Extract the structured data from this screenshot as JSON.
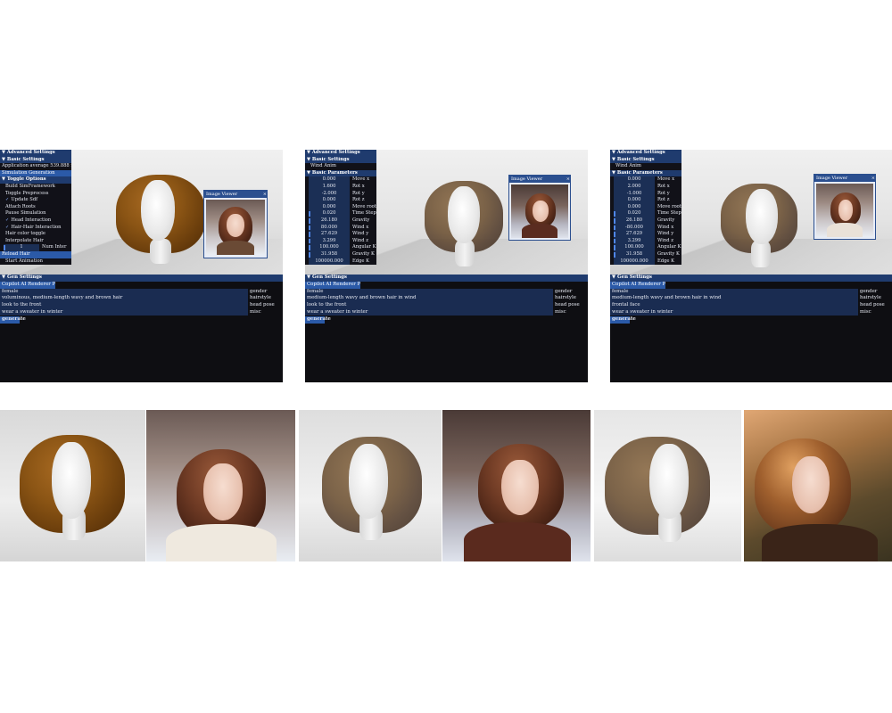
{
  "panel1": {
    "ui_rows": [
      {
        "text": "Advanced Settings",
        "style": "hdr"
      },
      {
        "text": "Basic Settings",
        "style": "hdr"
      },
      {
        "text": "Application average 539.888 ms/f",
        "style": "plain"
      },
      {
        "text": "Simulation Generation",
        "style": "sel"
      },
      {
        "text": "Toggle Options",
        "style": "hdr"
      },
      {
        "text": "Build SimFramework",
        "style": "sub"
      },
      {
        "text": "Toggle Preprocess",
        "style": "sub"
      },
      {
        "text": "Update Sdf",
        "style": "chk"
      },
      {
        "text": "Attach Roots",
        "style": "sub"
      },
      {
        "text": "Pause Simulation",
        "style": "sub"
      },
      {
        "text": "Head Interaction",
        "style": "chk"
      },
      {
        "text": "Hair-Hair Interaction",
        "style": "chk"
      },
      {
        "text": "Hair color toggle",
        "style": "sub"
      },
      {
        "text": "Interpolate Hair",
        "style": "sub"
      }
    ],
    "num_input": {
      "value": "1",
      "label": "Num Inter"
    },
    "reload_label": "Reload Hair",
    "start_label": "Start Animation",
    "image_viewer_title": "Image Viewer",
    "gen": {
      "header": "Gen Settings",
      "section": "Copilot AI Renderer Perm",
      "rows": [
        {
          "value": "female",
          "label": "gender"
        },
        {
          "value": "voluminous, medium-length wavy and brown hair",
          "label": "hairstyle"
        },
        {
          "value": "look to the front",
          "label": "head pose"
        },
        {
          "value": "wear a sweater in winter",
          "label": "misc"
        }
      ],
      "button": "generate"
    }
  },
  "panel2": {
    "ui_rows": [
      {
        "text": "Advanced Settings",
        "style": "hdr"
      },
      {
        "text": "Basic Settings",
        "style": "hdr"
      },
      {
        "text": "Wind Anim",
        "style": "sub"
      },
      {
        "text": "Basic Parameters",
        "style": "hdr"
      }
    ],
    "params": [
      {
        "value": "0.000",
        "label": "Move x",
        "bar": false
      },
      {
        "value": "1.600",
        "label": "Rot x",
        "bar": false
      },
      {
        "value": "-2.000",
        "label": "Rot y",
        "bar": false
      },
      {
        "value": "0.000",
        "label": "Rot z",
        "bar": false
      },
      {
        "value": "0.000",
        "label": "Move root",
        "bar": false
      },
      {
        "value": "0.020",
        "label": "Time Step",
        "bar": true
      },
      {
        "value": "26.180",
        "label": "Gravity",
        "bar": true
      },
      {
        "value": "80.000",
        "label": "Wind x",
        "bar": true
      },
      {
        "value": "27.629",
        "label": "Wind y",
        "bar": true
      },
      {
        "value": "3.299",
        "label": "Wind z",
        "bar": true
      },
      {
        "value": "100.000",
        "label": "Angular K",
        "bar": true
      },
      {
        "value": "31.958",
        "label": "Gravity K",
        "bar": true
      },
      {
        "value": "100000.000",
        "label": "Edge K",
        "bar": false
      }
    ],
    "image_viewer_title": "Image Viewer",
    "gen": {
      "header": "Gen Settings",
      "section": "Copilot AI Renderer Perm",
      "rows": [
        {
          "value": "female",
          "label": "gender"
        },
        {
          "value": "medium-length wavy and brown hair in wind",
          "label": "hairstyle"
        },
        {
          "value": "look to the front",
          "label": "head pose"
        },
        {
          "value": "wear a sweater in winter",
          "label": "misc"
        }
      ],
      "button": "generate"
    }
  },
  "panel3": {
    "ui_rows": [
      {
        "text": "Advanced Settings",
        "style": "hdr"
      },
      {
        "text": "Basic Settings",
        "style": "hdr"
      },
      {
        "text": "Wind Anim",
        "style": "sub"
      },
      {
        "text": "Basic Parameters",
        "style": "hdr"
      }
    ],
    "params": [
      {
        "value": "0.000",
        "label": "Move x",
        "bar": false
      },
      {
        "value": "2.000",
        "label": "Rot x",
        "bar": false
      },
      {
        "value": "-1.000",
        "label": "Rot y",
        "bar": false
      },
      {
        "value": "0.000",
        "label": "Rot z",
        "bar": false
      },
      {
        "value": "0.000",
        "label": "Move root",
        "bar": false
      },
      {
        "value": "0.020",
        "label": "Time Step",
        "bar": true
      },
      {
        "value": "26.180",
        "label": "Gravity",
        "bar": true
      },
      {
        "value": "-80.000",
        "label": "Wind x",
        "bar": true
      },
      {
        "value": "27.629",
        "label": "Wind y",
        "bar": true
      },
      {
        "value": "3.299",
        "label": "Wind z",
        "bar": true
      },
      {
        "value": "100.000",
        "label": "Angular K",
        "bar": true
      },
      {
        "value": "31.958",
        "label": "Gravity K",
        "bar": true
      },
      {
        "value": "100000.000",
        "label": "Edge K",
        "bar": false
      }
    ],
    "image_viewer_title": "Image Viewer",
    "gen": {
      "header": "Gen Settings",
      "section": "Copilot AI Renderer Perm",
      "rows": [
        {
          "value": "female",
          "label": "gender"
        },
        {
          "value": "medium-length wavy and brown hair in wind",
          "label": "hairstyle"
        },
        {
          "value": "frontal face",
          "label": "head pose"
        },
        {
          "value": "wear a sweater in winter",
          "label": "misc"
        }
      ],
      "button": "generate"
    }
  },
  "close_glyph": "×",
  "collapse_glyph": "▼"
}
